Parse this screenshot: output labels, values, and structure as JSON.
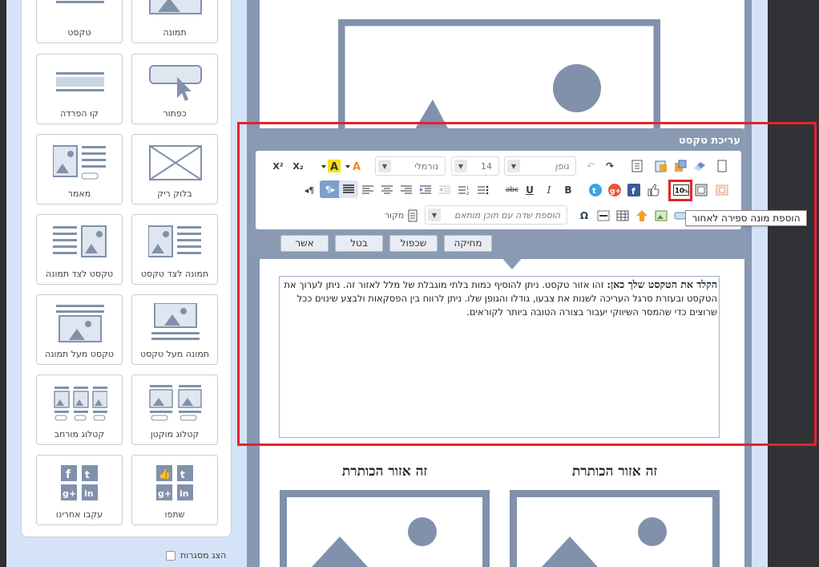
{
  "palette": {
    "tiles": [
      {
        "label": "טקסט",
        "icon": "text-block-icon"
      },
      {
        "label": "תמונה",
        "icon": "image-block-icon"
      },
      {
        "label": "קו הפרדה",
        "icon": "divider-icon"
      },
      {
        "label": "כפתור",
        "icon": "button-block-icon"
      },
      {
        "label": "מאמר",
        "icon": "article-icon"
      },
      {
        "label": "בלוק ריק",
        "icon": "empty-block-icon"
      },
      {
        "label": "טקסט לצד תמונה",
        "icon": "text-beside-image-icon"
      },
      {
        "label": "תמונה לצד טקסט",
        "icon": "image-beside-text-icon"
      },
      {
        "label": "טקסט מעל תמונה",
        "icon": "text-above-image-icon"
      },
      {
        "label": "תמונה מעל טקסט",
        "icon": "image-above-text-icon"
      },
      {
        "label": "קטלוג מורחב",
        "icon": "wide-catalog-icon"
      },
      {
        "label": "קטלוג מוקטן",
        "icon": "small-catalog-icon"
      },
      {
        "label": "עקבו אחרינו",
        "icon": "follow-us-icon"
      },
      {
        "label": "שתפו",
        "icon": "share-icon"
      }
    ],
    "show_frames_label": "הצג מסגרות"
  },
  "editor": {
    "title": "עריכת טקסט",
    "font_placeholder": "גופן",
    "font_size": "14",
    "paragraph_style": "נורמלי",
    "merge_field_placeholder": "הוספת שדה עם תוכן מותאם",
    "source_label": "מקור",
    "buttons": {
      "delete": "מחיקה",
      "duplicate": "שכפול",
      "cancel": "בטל",
      "confirm": "אשר"
    },
    "tooltip": "הוספת מונה ספירה לאחור",
    "counter_icon_text": "10%"
  },
  "content": {
    "bold_lead": "הקלד את הטקסט שלך כאן:",
    "body": " זהו אזור טקסט. ניתן להוסיף כמות בלתי מוגבלת של מלל לאזור זה. ניתן לערוך את הטקסט ובעזרת סרגל העריכה לשנות את צבעו, גודלו והגופן שלו. ניתן לרווח בין הפסקאות ולבצע שינוים ככל שרוצים כדי שהמסר השיווקי יעבור בצורה הטובה ביותר לקוראים."
  },
  "columns": {
    "right_title": "זה אזור הכותרת",
    "left_title": "זה אזור הכותרת"
  },
  "colors": {
    "highlight": "#e3232b",
    "editor_bg": "#8a9ab3",
    "placeholder_fill": "#8191ac"
  }
}
